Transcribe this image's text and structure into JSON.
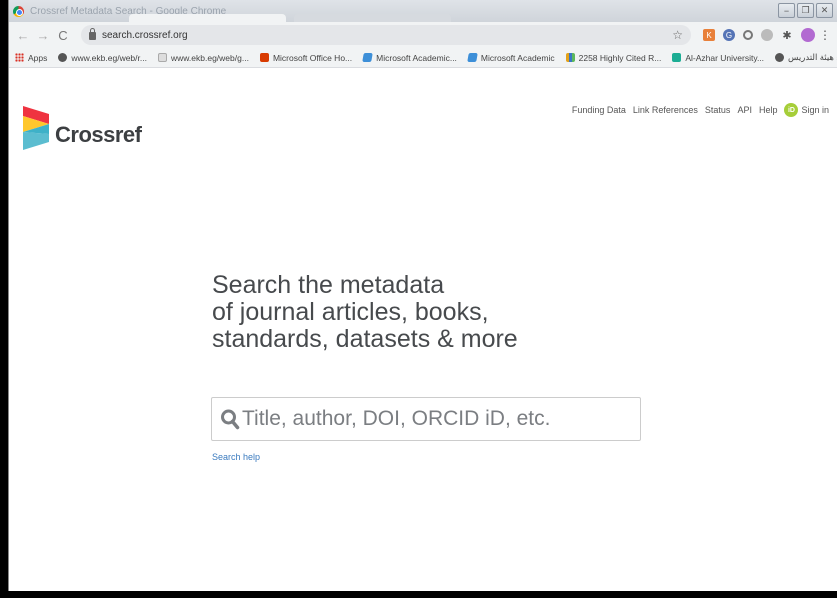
{
  "window": {
    "title": "Crossref Metadata Search - Google Chrome",
    "controls": [
      "−",
      "❐",
      "✕"
    ]
  },
  "toolbar": {
    "back": "←",
    "forward": "→",
    "reload": "C",
    "url": "search.crossref.org",
    "star": "☆",
    "menu": "⋮"
  },
  "bookmarks": {
    "items": [
      {
        "label": "Apps",
        "icon": "apps-icon"
      },
      {
        "label": "www.ekb.eg/web/r...",
        "icon": "globe-icon"
      },
      {
        "label": "www.ekb.eg/web/g...",
        "icon": "page-icon"
      },
      {
        "label": "Microsoft Office Ho...",
        "icon": "office-icon"
      },
      {
        "label": "Microsoft Academic...",
        "icon": "microsoft-academic-icon"
      },
      {
        "label": "Microsoft Academic",
        "icon": "microsoft-academic-icon"
      },
      {
        "label": "2258 Highly Cited R...",
        "icon": "chart-icon"
      },
      {
        "label": "Al-Azhar University...",
        "icon": "researchgate-icon"
      },
      {
        "label": "أعضاء هيئة التدريس...",
        "icon": "globe-icon"
      }
    ],
    "more": "»"
  },
  "page": {
    "logo_text": "Crossref",
    "nav": {
      "funding_data": "Funding Data",
      "link_references": "Link References",
      "status": "Status",
      "api": "API",
      "help": "Help",
      "orcid_badge": "iD",
      "sign_in": "Sign in"
    },
    "headline": [
      "Search the metadata",
      "of journal articles, books,",
      "standards, datasets & more"
    ],
    "search": {
      "placeholder": "Title, author, DOI, ORCID iD, etc."
    },
    "search_help": "Search help"
  },
  "colors": {
    "logo_red": "#ef3340",
    "logo_yellow": "#ffc72c",
    "logo_teal": "#3eb1c8",
    "link_blue": "#3b7bbf",
    "orcid_green": "#a6ce39"
  }
}
